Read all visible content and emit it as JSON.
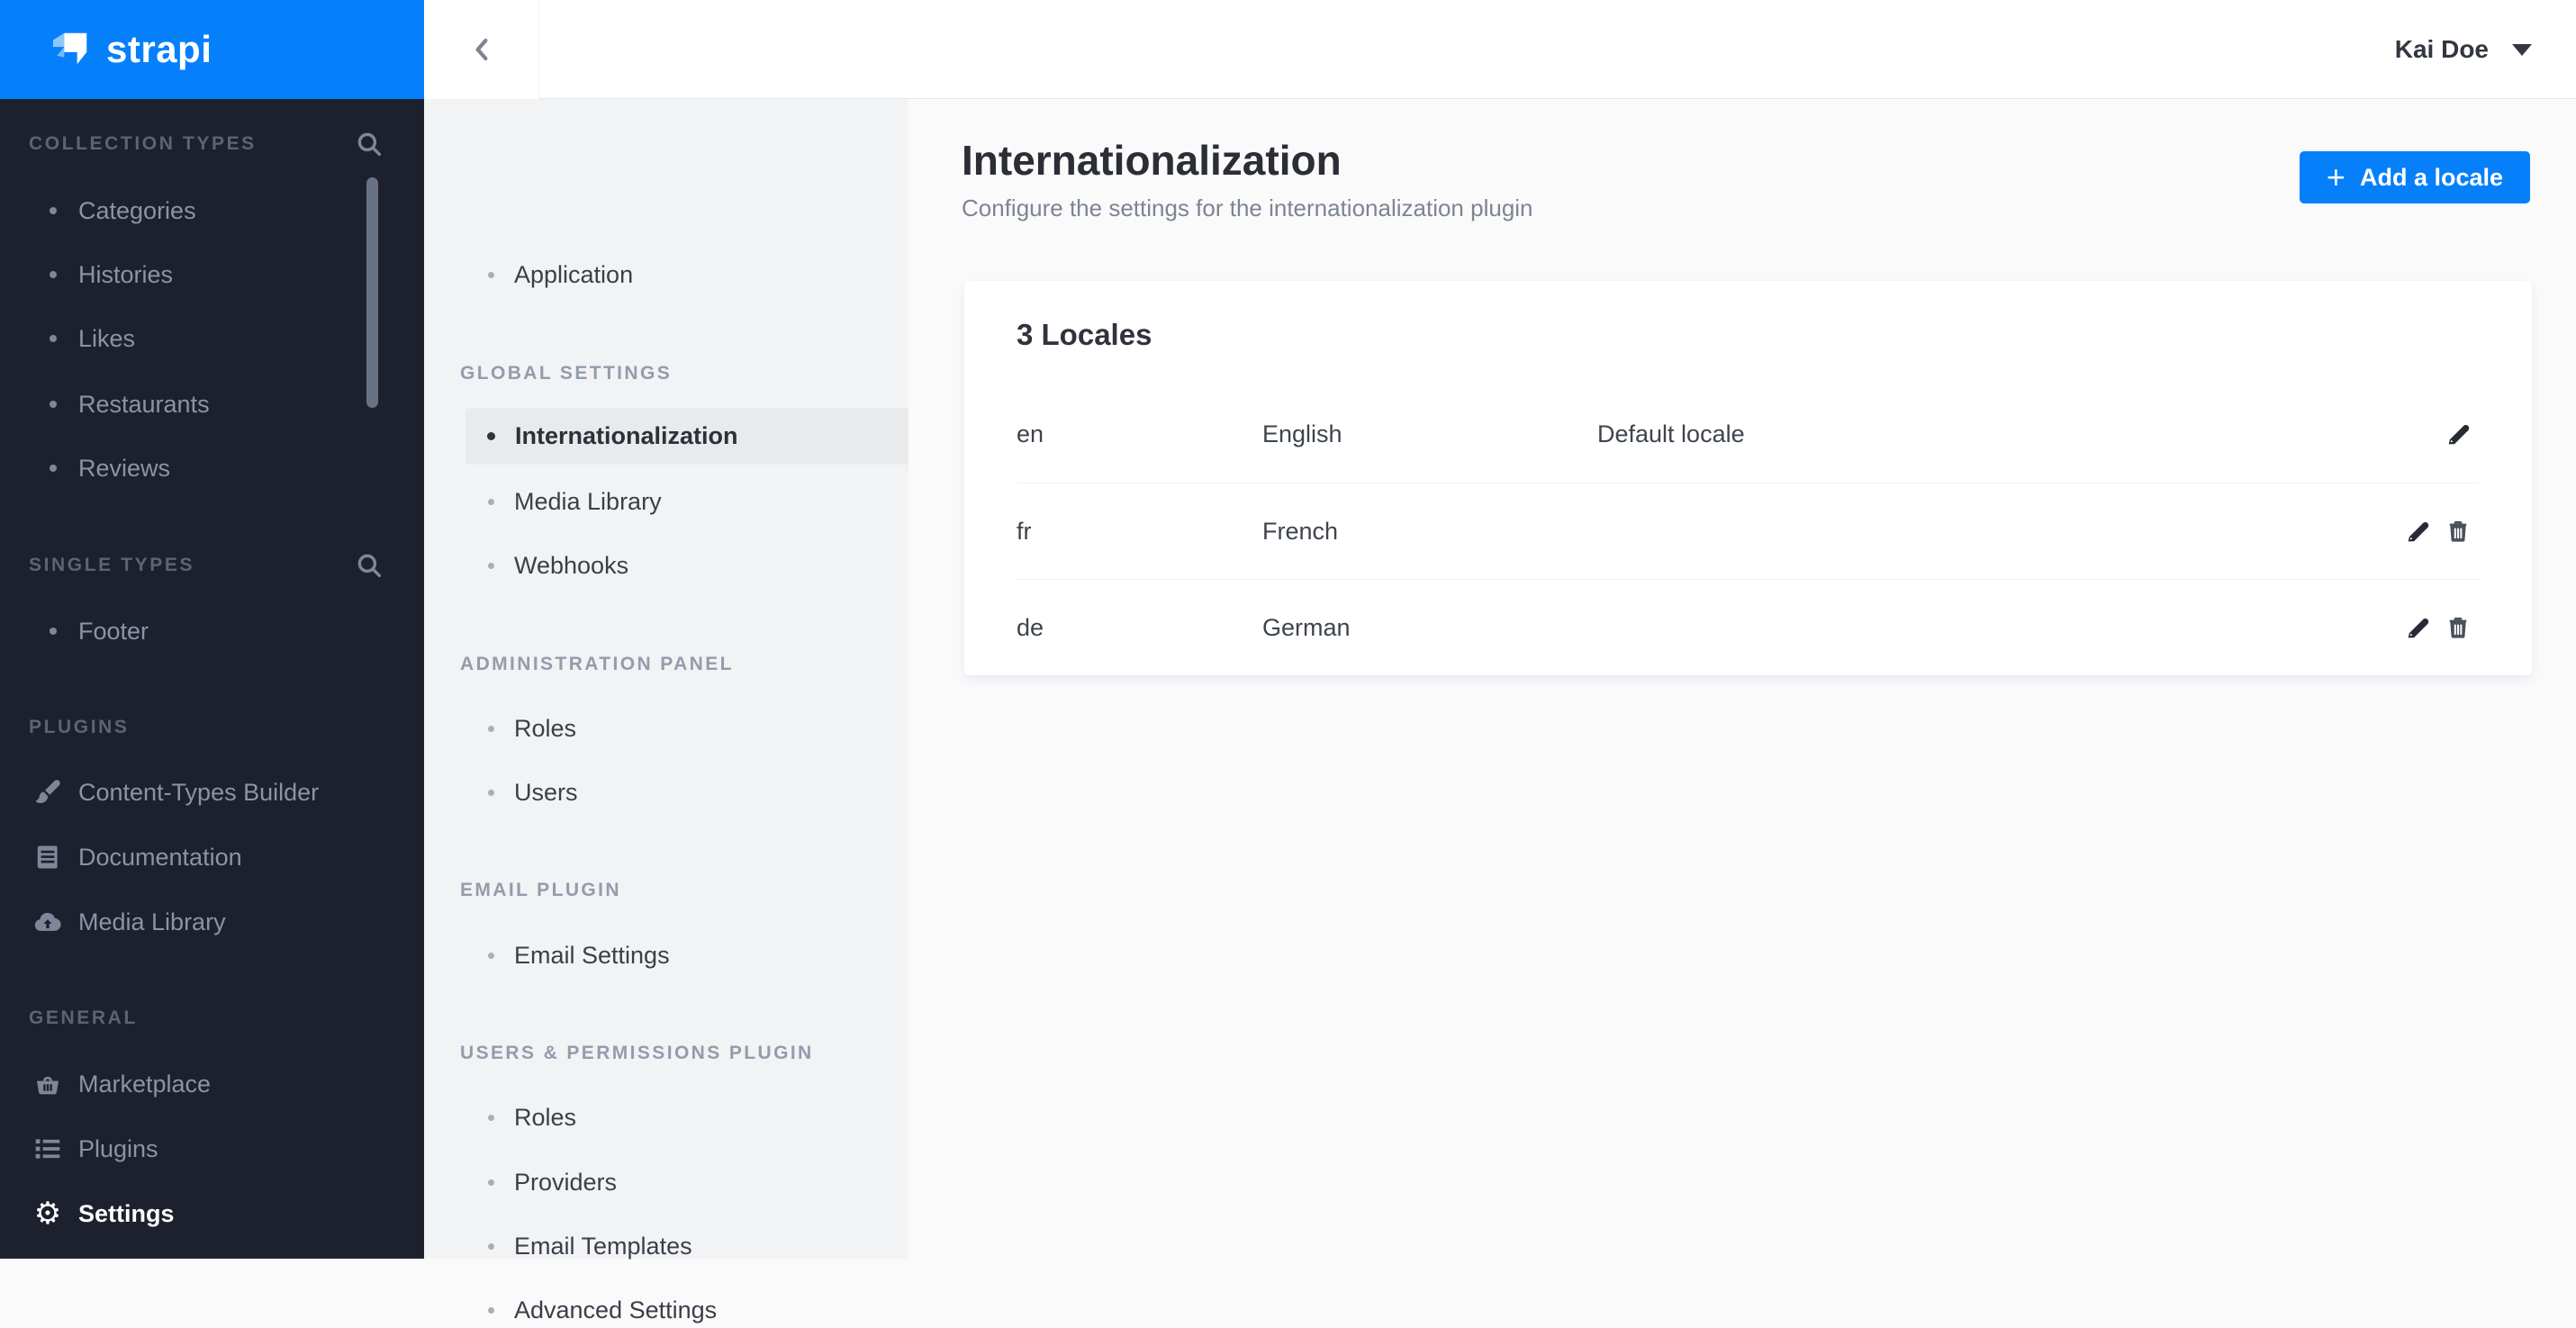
{
  "brand": {
    "logo_text": "strapi"
  },
  "topbar": {
    "user_name": "Kai Doe",
    "back_icon": "chevron-left"
  },
  "sidebar": {
    "sections": [
      {
        "label": "COLLECTION TYPES",
        "has_search": true,
        "items": [
          {
            "label": "Categories"
          },
          {
            "label": "Histories"
          },
          {
            "label": "Likes"
          },
          {
            "label": "Restaurants"
          },
          {
            "label": "Reviews"
          }
        ]
      },
      {
        "label": "SINGLE TYPES",
        "has_search": true,
        "items": [
          {
            "label": "Footer"
          }
        ]
      },
      {
        "label": "PLUGINS",
        "items": [
          {
            "label": "Content-Types Builder",
            "icon": "paintbrush-icon"
          },
          {
            "label": "Documentation",
            "icon": "book-icon"
          },
          {
            "label": "Media Library",
            "icon": "cloud-upload-icon"
          }
        ]
      },
      {
        "label": "GENERAL",
        "items": [
          {
            "label": "Marketplace",
            "icon": "basket-icon"
          },
          {
            "label": "Plugins",
            "icon": "list-icon"
          },
          {
            "label": "Settings",
            "icon": "gear-icon",
            "active": true
          }
        ]
      }
    ]
  },
  "subnav": {
    "top_items": [
      {
        "label": "Application"
      }
    ],
    "sections": [
      {
        "label": "GLOBAL SETTINGS",
        "items": [
          {
            "label": "Internationalization",
            "active": true
          },
          {
            "label": "Media Library"
          },
          {
            "label": "Webhooks"
          }
        ]
      },
      {
        "label": "ADMINISTRATION PANEL",
        "items": [
          {
            "label": "Roles"
          },
          {
            "label": "Users"
          }
        ]
      },
      {
        "label": "EMAIL PLUGIN",
        "items": [
          {
            "label": "Email Settings"
          }
        ]
      },
      {
        "label": "USERS & PERMISSIONS PLUGIN",
        "items": [
          {
            "label": "Roles"
          },
          {
            "label": "Providers"
          },
          {
            "label": "Email Templates"
          },
          {
            "label": "Advanced Settings"
          }
        ]
      }
    ]
  },
  "main": {
    "page_title": "Internationalization",
    "page_subtitle": "Configure the settings for the internationalization plugin",
    "add_locale_button": {
      "plus_glyph": "+",
      "label": "Add a locale"
    },
    "gear_glyph": "⚙",
    "locales_card": {
      "title": "3 Locales",
      "rows": [
        {
          "code": "en",
          "display_name": "English",
          "note": "Default locale",
          "actions": [
            "edit"
          ]
        },
        {
          "code": "fr",
          "display_name": "French",
          "note": "",
          "actions": [
            "edit",
            "delete"
          ]
        },
        {
          "code": "de",
          "display_name": "German",
          "note": "",
          "actions": [
            "edit",
            "delete"
          ]
        }
      ]
    }
  },
  "colors": {
    "accent_blue": "#0680FA",
    "sidebar_bg": "#1C212D",
    "subnav_bg": "#F2F3F5",
    "content_bg": "#FAFAFB",
    "active_item_bg": "#E8EAEC",
    "title_text": "#2B2E34",
    "muted_text": "#7D8494",
    "row_text": "#3E444E"
  }
}
